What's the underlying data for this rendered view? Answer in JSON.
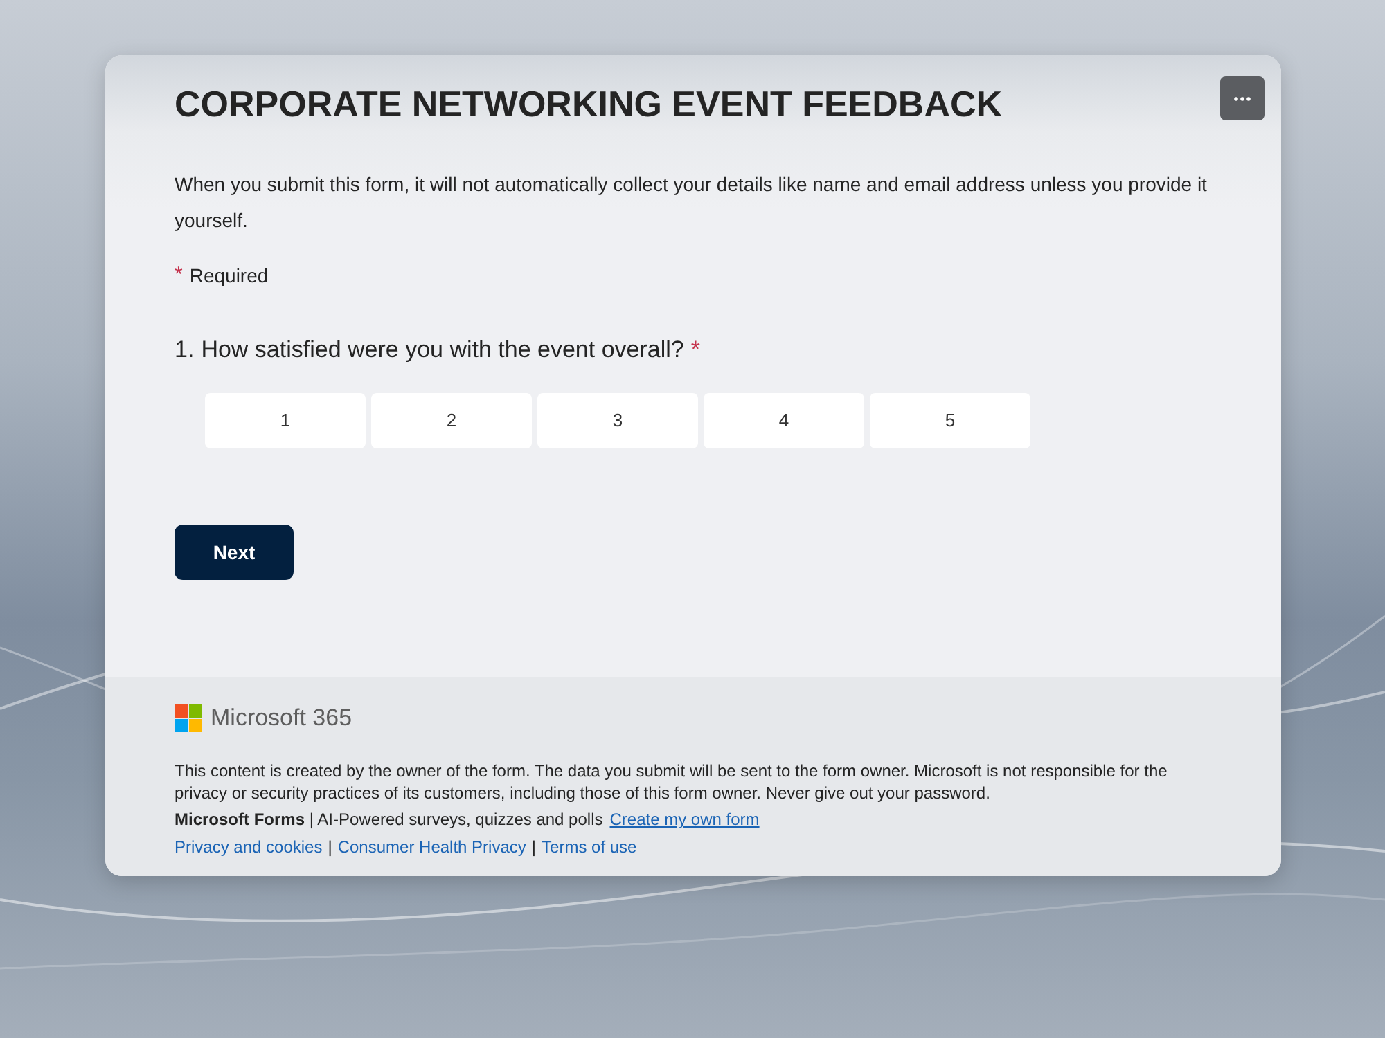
{
  "form": {
    "title": "CORPORATE NETWORKING EVENT FEEDBACK",
    "description": "When you submit this form, it will not automatically collect your details like name and email address unless you provide it yourself.",
    "required_note": {
      "mark": "*",
      "label": "Required"
    },
    "questions": [
      {
        "number": "1.",
        "text": "How satisfied were you with the event overall?",
        "required_mark": "*",
        "options": [
          {
            "label": "1",
            "selected": false
          },
          {
            "label": "2",
            "selected": false
          },
          {
            "label": "3",
            "selected": false
          },
          {
            "label": "4",
            "selected": false
          },
          {
            "label": "5",
            "selected": false
          }
        ]
      }
    ],
    "next_button": "Next"
  },
  "footer": {
    "brand": "Microsoft 365",
    "disclaimer": "This content is created by the owner of the form. The data you submit will be sent to the form owner. Microsoft is not responsible for the privacy or security practices of its customers, including those of this form owner. Never give out your password.",
    "product_line": "**Microsoft Forms** | AI-Powered surveys, quizzes and polls",
    "create_link": "Create my own form",
    "links": [
      {
        "label": "Privacy and cookies"
      },
      {
        "label": "Consumer Health Privacy"
      },
      {
        "label": "Terms of use"
      }
    ],
    "link_separators": [
      "|",
      "|"
    ]
  }
}
